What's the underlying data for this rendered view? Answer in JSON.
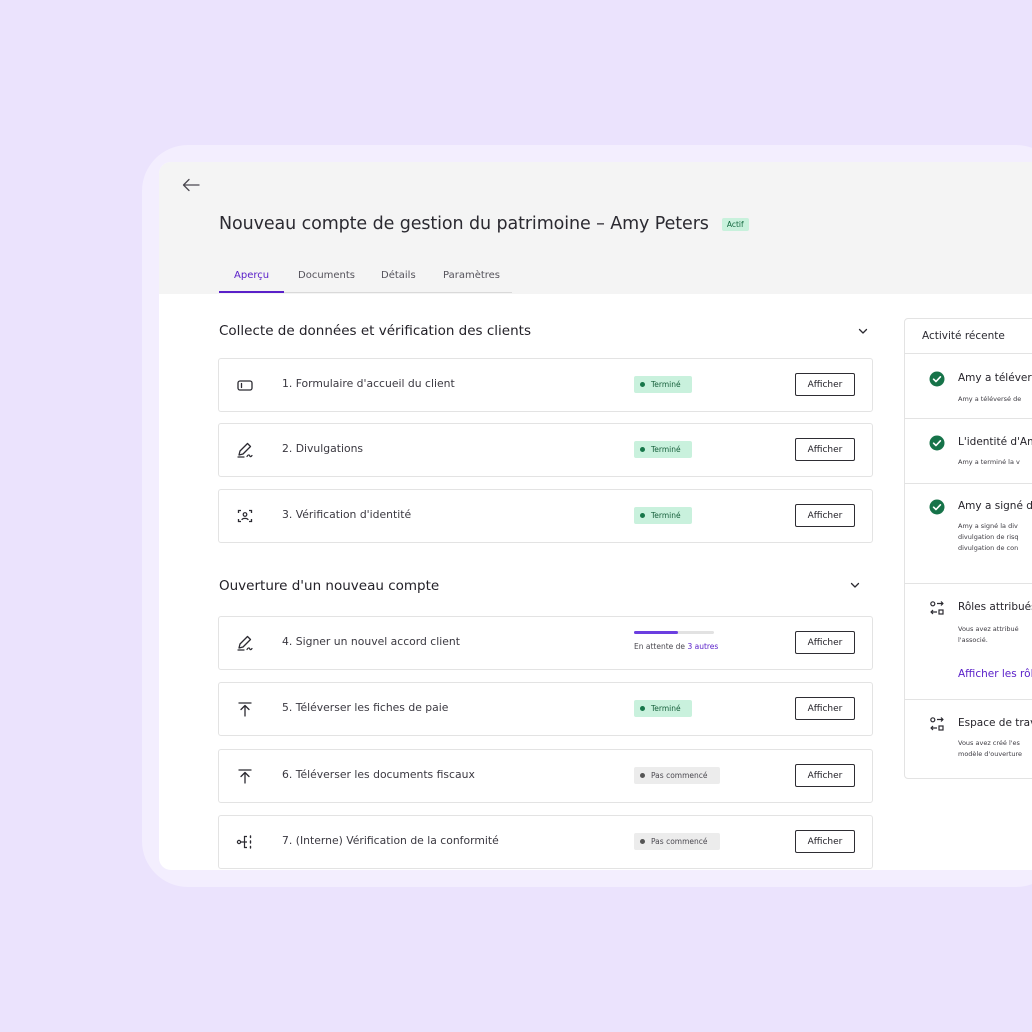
{
  "header": {
    "title": "Nouveau compte de gestion du patrimoine – Amy Peters",
    "status_badge": "Actif",
    "tabs": [
      {
        "label": "Aperçu",
        "active": true
      },
      {
        "label": "Documents",
        "active": false
      },
      {
        "label": "Détails",
        "active": false
      },
      {
        "label": "Paramètres",
        "active": false
      }
    ]
  },
  "sections": [
    {
      "title": "Collecte de données et vérification des clients",
      "tasks": [
        {
          "label": "1. Formulaire d'accueil du client",
          "icon": "form-icon",
          "status": "Terminé",
          "action": "Afficher"
        },
        {
          "label": "2. Divulgations",
          "icon": "signature-icon",
          "status": "Terminé",
          "action": "Afficher"
        },
        {
          "label": "3. Vérification d'identité",
          "icon": "face-scan-icon",
          "status": "Terminé",
          "action": "Afficher"
        }
      ]
    },
    {
      "title": "Ouverture d'un nouveau compte",
      "tasks": [
        {
          "label": "4. Signer un nouvel accord client",
          "icon": "signature-icon",
          "waiting_prefix": "En attente de",
          "waiting_link": "3 autres",
          "progress": 0.55,
          "action": "Afficher"
        },
        {
          "label": "5. Téléverser les fiches de paie",
          "icon": "upload-icon",
          "status": "Terminé",
          "action": "Afficher"
        },
        {
          "label": "6. Téléverser les documents fiscaux",
          "icon": "upload-icon",
          "status": "Pas commencé",
          "action": "Afficher"
        },
        {
          "label": "7. (Interne) Vérification de la conformité",
          "icon": "workflow-icon",
          "status": "Pas commencé",
          "action": "Afficher"
        }
      ]
    }
  ],
  "activity": {
    "title": "Activité récente",
    "items": [
      {
        "icon": "check-circle-icon",
        "head": "Amy a télévers",
        "body": "Amy a téléversé de"
      },
      {
        "icon": "check-circle-icon",
        "head": "L'identité d'Am",
        "body": "Amy a terminé la v"
      },
      {
        "icon": "check-circle-icon",
        "head": "Amy a signé de",
        "body": "Amy a signé la div\ndivulgation de risq\ndivulgation de con"
      },
      {
        "icon": "roles-icon",
        "head": "Rôles attribués",
        "body": "Vous avez attribué\nl'associé.",
        "link": "Afficher les rôl"
      },
      {
        "icon": "roles-icon",
        "head": "Espace de trav",
        "body": "Vous avez créé l'es\nmodèle d'ouverture"
      }
    ]
  },
  "colors": {
    "background": "#ebe3fd",
    "accent": "#5a20c9",
    "success_bg": "#c9f1dd",
    "success_dot": "#17774a",
    "success_icon": "#167349"
  }
}
